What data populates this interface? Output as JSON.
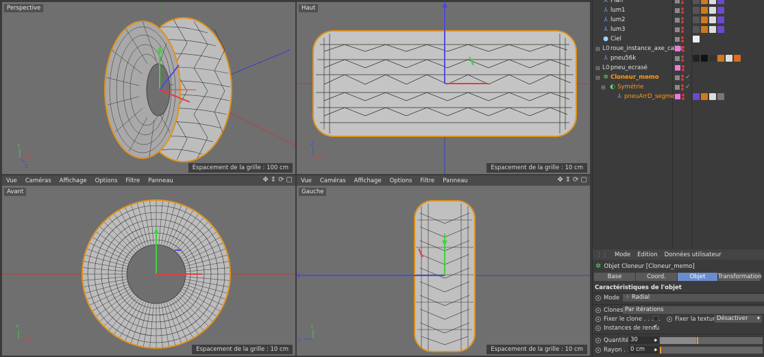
{
  "viewports": {
    "perspective": {
      "label": "Perspective",
      "grid": "Espacement de la grille : 100 cm"
    },
    "top": {
      "label": "Haut",
      "grid": "Espacement de la grille : 10 cm"
    },
    "front": {
      "label": "Avant",
      "grid": "Espacement de la grille : 10 cm"
    },
    "left": {
      "label": "Gauche",
      "grid": "Espacement de la grille : 10 cm"
    }
  },
  "viewport_menu": [
    "Vue",
    "Caméras",
    "Affichage",
    "Options",
    "Filtre",
    "Panneau"
  ],
  "objects": [
    {
      "name": "Plan",
      "indent": 0,
      "type": "light",
      "style": "normal"
    },
    {
      "name": "lum1",
      "indent": 0,
      "type": "light",
      "style": "normal"
    },
    {
      "name": "lum2",
      "indent": 0,
      "type": "light",
      "style": "normal"
    },
    {
      "name": "lum3",
      "indent": 0,
      "type": "light",
      "style": "normal"
    },
    {
      "name": "Ciel",
      "indent": 0,
      "type": "sky",
      "style": "normal"
    },
    {
      "name": "roue_instance_axe_calée",
      "indent": 0,
      "type": "null",
      "style": "normal"
    },
    {
      "name": "pneu56k",
      "indent": 0,
      "type": "mesh",
      "style": "normal"
    },
    {
      "name": "pneu_ecrasé",
      "indent": 0,
      "type": "null",
      "style": "normal"
    },
    {
      "name": "Cloneur_memo",
      "indent": 0,
      "type": "cloner",
      "style": "orange"
    },
    {
      "name": "Symétrie",
      "indent": 1,
      "type": "symmetry",
      "style": "orange2"
    },
    {
      "name": "pneuArrD_segment",
      "indent": 2,
      "type": "mesh",
      "style": "orange2"
    }
  ],
  "attributes": {
    "menu": [
      "Mode",
      "Edition",
      "Données utilisateur"
    ],
    "title": "Objet Cloneur [Cloneur_memo]",
    "tabs": [
      "Base",
      "Coord.",
      "Objet",
      "Transformation"
    ],
    "active_tab": "Objet",
    "section": "Caractéristiques de l'objet",
    "mode_label": "Mode",
    "mode_value": "Radial",
    "clones_label": "Clones",
    "clones_value": "Par itérations",
    "fix_clone_label": "Fixer le clone . . . . .",
    "fix_texture_label": "Fixer la texture",
    "fix_texture_value": "Désactiver",
    "render_instances_label": "Instances de rendu",
    "render_instances_check": "✓",
    "quantity_label": "Quantité",
    "quantity_value": "30",
    "quantity_fraction": 0.35,
    "radius_label": "Rayon . . .",
    "radius_value": "0 cm"
  }
}
